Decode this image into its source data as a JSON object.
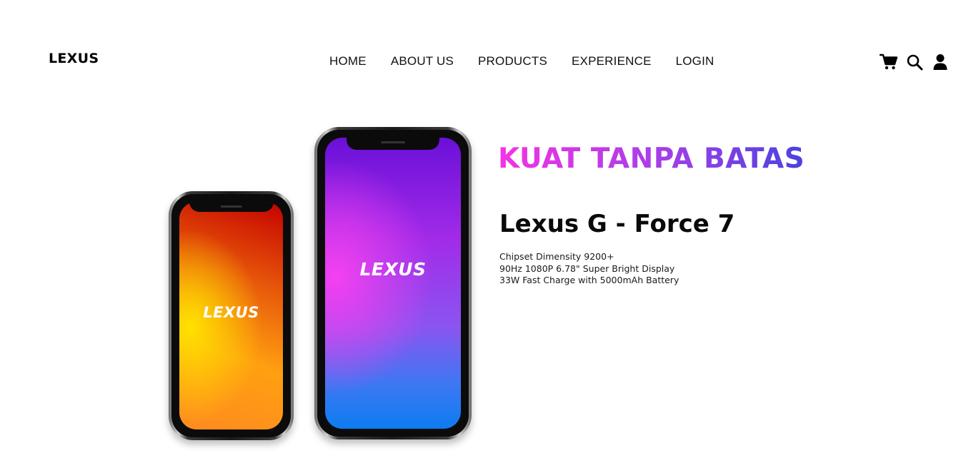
{
  "header": {
    "logo": "LEXUS",
    "nav": [
      "HOME",
      "ABOUT US",
      "PRODUCTS",
      "EXPERIENCE",
      "LOGIN"
    ],
    "icons": [
      "cart-icon",
      "search-icon",
      "user-icon"
    ]
  },
  "hero": {
    "phones": [
      {
        "screen_text": "LEXUS",
        "gradient": [
          "#c40000",
          "#ff8a20",
          "#ffe100"
        ]
      },
      {
        "screen_text": "LEXUS",
        "gradient": [
          "#6a10d8",
          "#f440f0",
          "#0d7cf0"
        ]
      }
    ],
    "headline": "KUAT TANPA BATAS",
    "headline_gradient": [
      "#f433e6",
      "#4a42e0"
    ],
    "product_name": "Lexus G - Force 7",
    "specs": [
      "Chipset Dimensity 9200+",
      "90Hz 1080P 6.78\" Super Bright Display",
      "33W Fast Charge with 5000mAh Battery"
    ]
  }
}
